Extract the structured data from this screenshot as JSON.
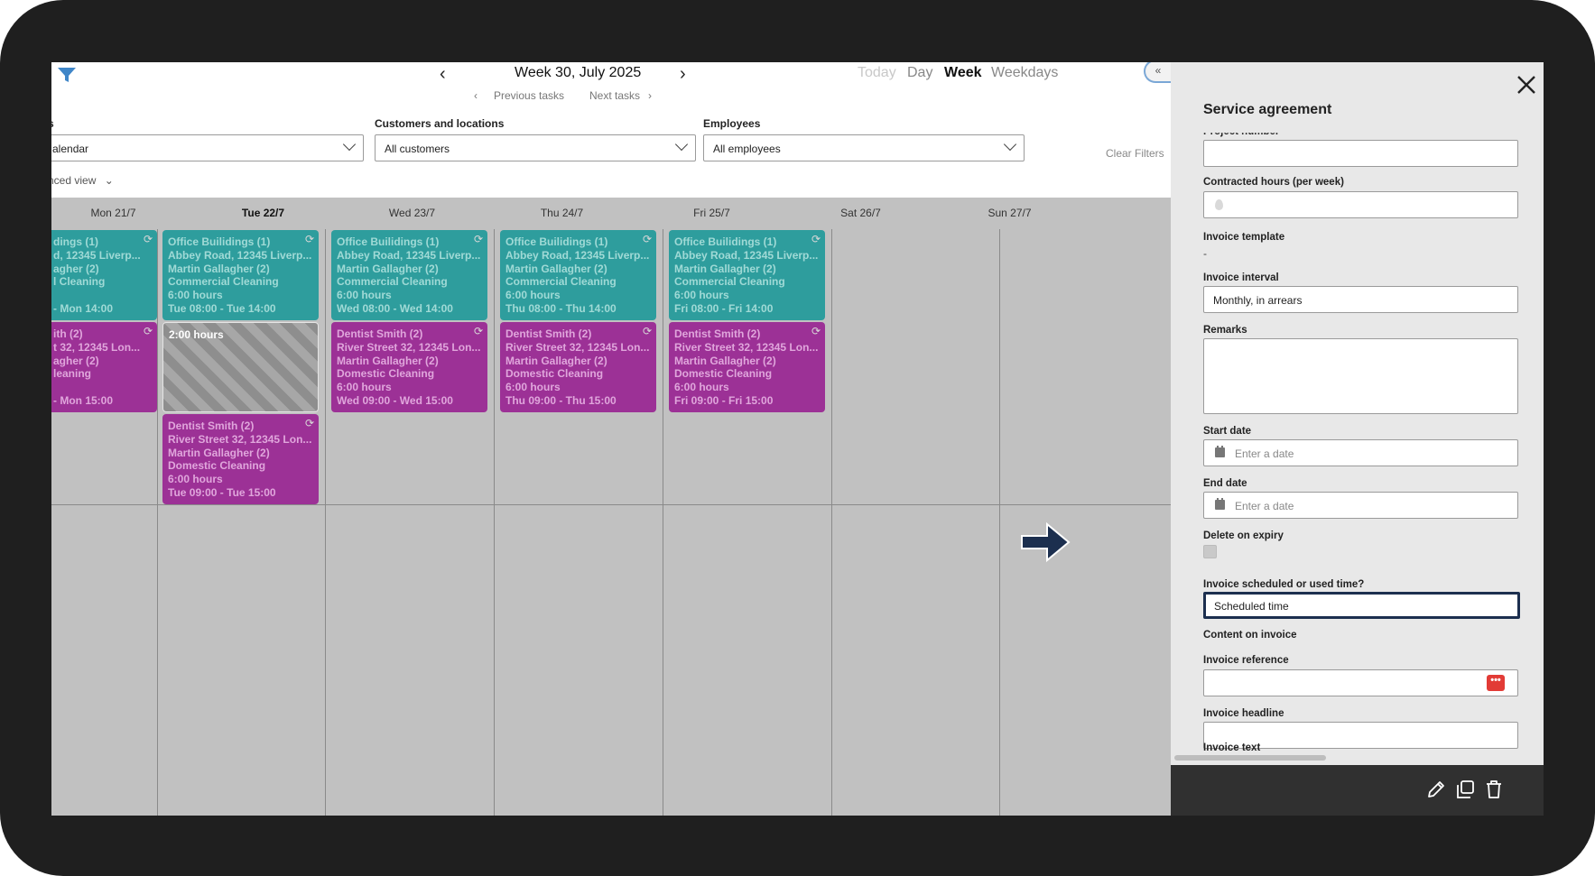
{
  "calendar": {
    "week_title": "Week 30, July 2025",
    "prev_tasks": "Previous tasks",
    "next_tasks": "Next tasks",
    "views": [
      "Today",
      "Day",
      "Week",
      "Weekdays"
    ],
    "active_view": "Week",
    "filters": {
      "calendar_label": "s",
      "calendar_value": "alendar",
      "customers_label": "Customers and locations",
      "customers_value": "All customers",
      "employees_label": "Employees",
      "employees_value": "All employees",
      "clear_label": "Clear Filters",
      "advanced_label": "nced view"
    },
    "days": [
      "Mon 21/7",
      "Tue 22/7",
      "Wed 23/7",
      "Thu 24/7",
      "Fri 25/7",
      "Sat 26/7",
      "Sun 27/7"
    ],
    "today": "Tue 22/7",
    "events": {
      "mon_teal": [
        "dings (1)",
        "d, 12345 Liverp...",
        "agher (2)",
        "l Cleaning",
        "",
        "- Mon 14:00"
      ],
      "mon_purple": [
        "ith (2)",
        "t 32, 12345 Lon...",
        "agher (2)",
        "leaning",
        "",
        "- Mon 15:00"
      ],
      "tue_teal": [
        "Office Builidings (1)",
        "Abbey Road, 12345 Liverp...",
        "Martin Gallagher (2)",
        "Commercial Cleaning",
        "6:00 hours",
        "Tue 08:00 - Tue 14:00"
      ],
      "tue_gap": "2:00 hours",
      "tue_purple": [
        "Dentist Smith (2)",
        "River Street 32, 12345 Lon...",
        "Martin Gallagher (2)",
        "Domestic Cleaning",
        "6:00 hours",
        "Tue 09:00 - Tue 15:00"
      ],
      "wed_teal": [
        "Office Builidings (1)",
        "Abbey Road, 12345 Liverp...",
        "Martin Gallagher (2)",
        "Commercial Cleaning",
        "6:00 hours",
        "Wed 08:00 - Wed 14:00"
      ],
      "wed_purple": [
        "Dentist Smith (2)",
        "River Street 32, 12345 Lon...",
        "Martin Gallagher (2)",
        "Domestic Cleaning",
        "6:00 hours",
        "Wed 09:00 - Wed 15:00"
      ],
      "thu_teal": [
        "Office Builidings (1)",
        "Abbey Road, 12345 Liverp...",
        "Martin Gallagher (2)",
        "Commercial Cleaning",
        "6:00 hours",
        "Thu 08:00 - Thu 14:00"
      ],
      "thu_purple": [
        "Dentist Smith (2)",
        "River Street 32, 12345 Lon...",
        "Martin Gallagher (2)",
        "Domestic Cleaning",
        "6:00 hours",
        "Thu 09:00 - Thu 15:00"
      ],
      "fri_teal": [
        "Office Builidings (1)",
        "Abbey Road, 12345 Liverp...",
        "Martin Gallagher (2)",
        "Commercial Cleaning",
        "6:00 hours",
        "Fri 08:00 - Fri 14:00"
      ],
      "fri_purple": [
        "Dentist Smith (2)",
        "River Street 32, 12345 Lon...",
        "Martin Gallagher (2)",
        "Domestic Cleaning",
        "6:00 hours",
        "Fri 09:00 - Fri 15:00"
      ]
    },
    "colors": {
      "teal": "#2e9d9d",
      "purple": "#9c3196",
      "grid": "#c1c1c1"
    }
  },
  "panel": {
    "title": "Service agreement",
    "project_number_label": "Project number",
    "contracted_hours_label": "Contracted hours (per week)",
    "invoice_template_label": "Invoice template",
    "invoice_template_value": "-",
    "invoice_interval_label": "Invoice interval",
    "invoice_interval_value": "Monthly, in arrears",
    "remarks_label": "Remarks",
    "start_date_label": "Start date",
    "start_date_placeholder": "Enter a date",
    "end_date_label": "End date",
    "end_date_placeholder": "Enter a date",
    "delete_on_expiry_label": "Delete on expiry",
    "invoice_time_label": "Invoice scheduled or used time?",
    "invoice_time_value": "Scheduled time",
    "content_on_invoice_label": "Content on invoice",
    "invoice_reference_label": "Invoice reference",
    "invoice_headline_label": "Invoice headline",
    "invoice_text_label": "Invoice text",
    "ref_button_glyph": "•••",
    "icons": [
      "close-icon",
      "edit-icon",
      "copy-icon",
      "delete-icon"
    ],
    "highlight_color": "#1c2f4f"
  }
}
